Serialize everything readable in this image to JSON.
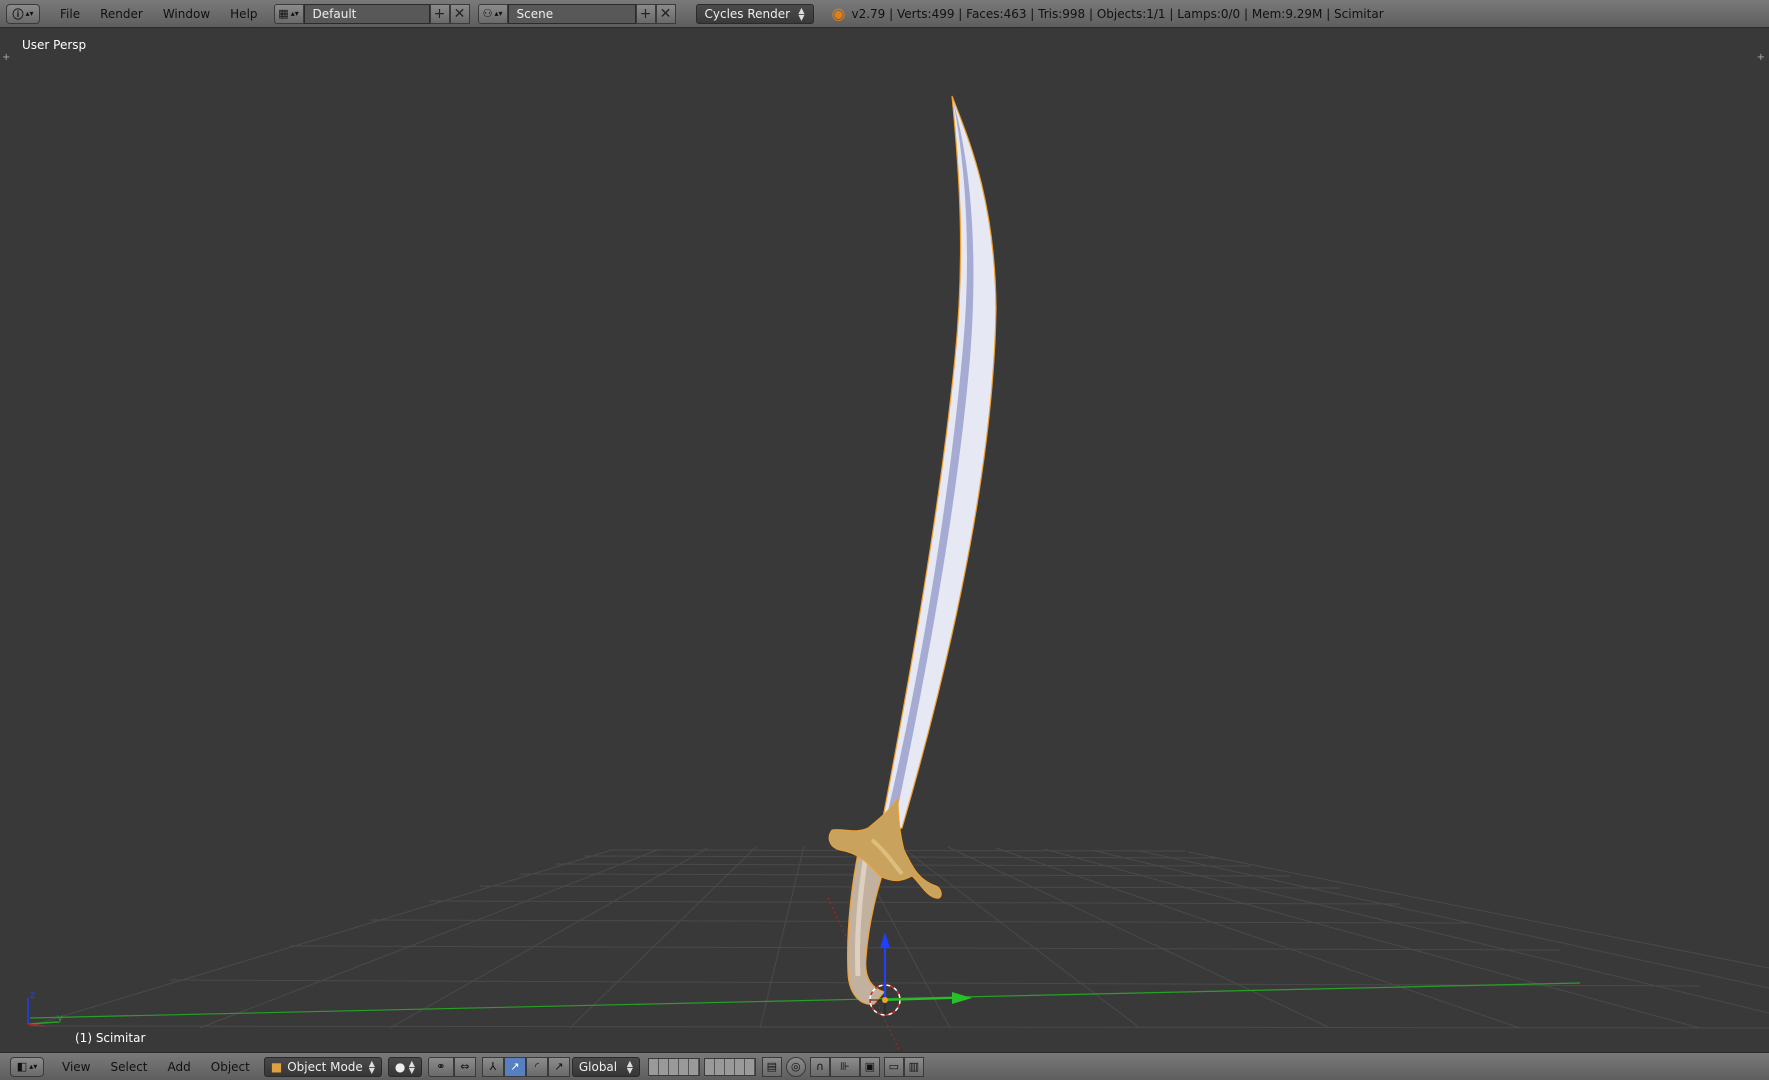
{
  "topbar": {
    "info_icon": "info-icon",
    "menu": [
      "File",
      "Render",
      "Window",
      "Help"
    ],
    "layout_name": "Default",
    "scene_name": "Scene",
    "render_engine": "Cycles Render",
    "stats": "v2.79 | Verts:499 | Faces:463 | Tris:998 | Objects:1/1 | Lamps:0/0 | Mem:9.29M | Scimitar"
  },
  "viewport": {
    "view_label": "User Persp",
    "object_label": "(1) Scimitar",
    "axis_labels": {
      "z": "z",
      "y": "y"
    },
    "colors": {
      "background": "#393939",
      "grid": "#4a4a4a",
      "x_axis": "#b02626",
      "y_axis": "#28a028",
      "z_axis": "#1e40ff",
      "selection_outline": "#f0a030",
      "blade": "#dfe2f0",
      "guard": "#c8a060",
      "handle": "#bfae9c"
    }
  },
  "bottombar": {
    "menu": [
      "View",
      "Select",
      "Add",
      "Object"
    ],
    "mode": "Object Mode",
    "orientation": "Global"
  }
}
